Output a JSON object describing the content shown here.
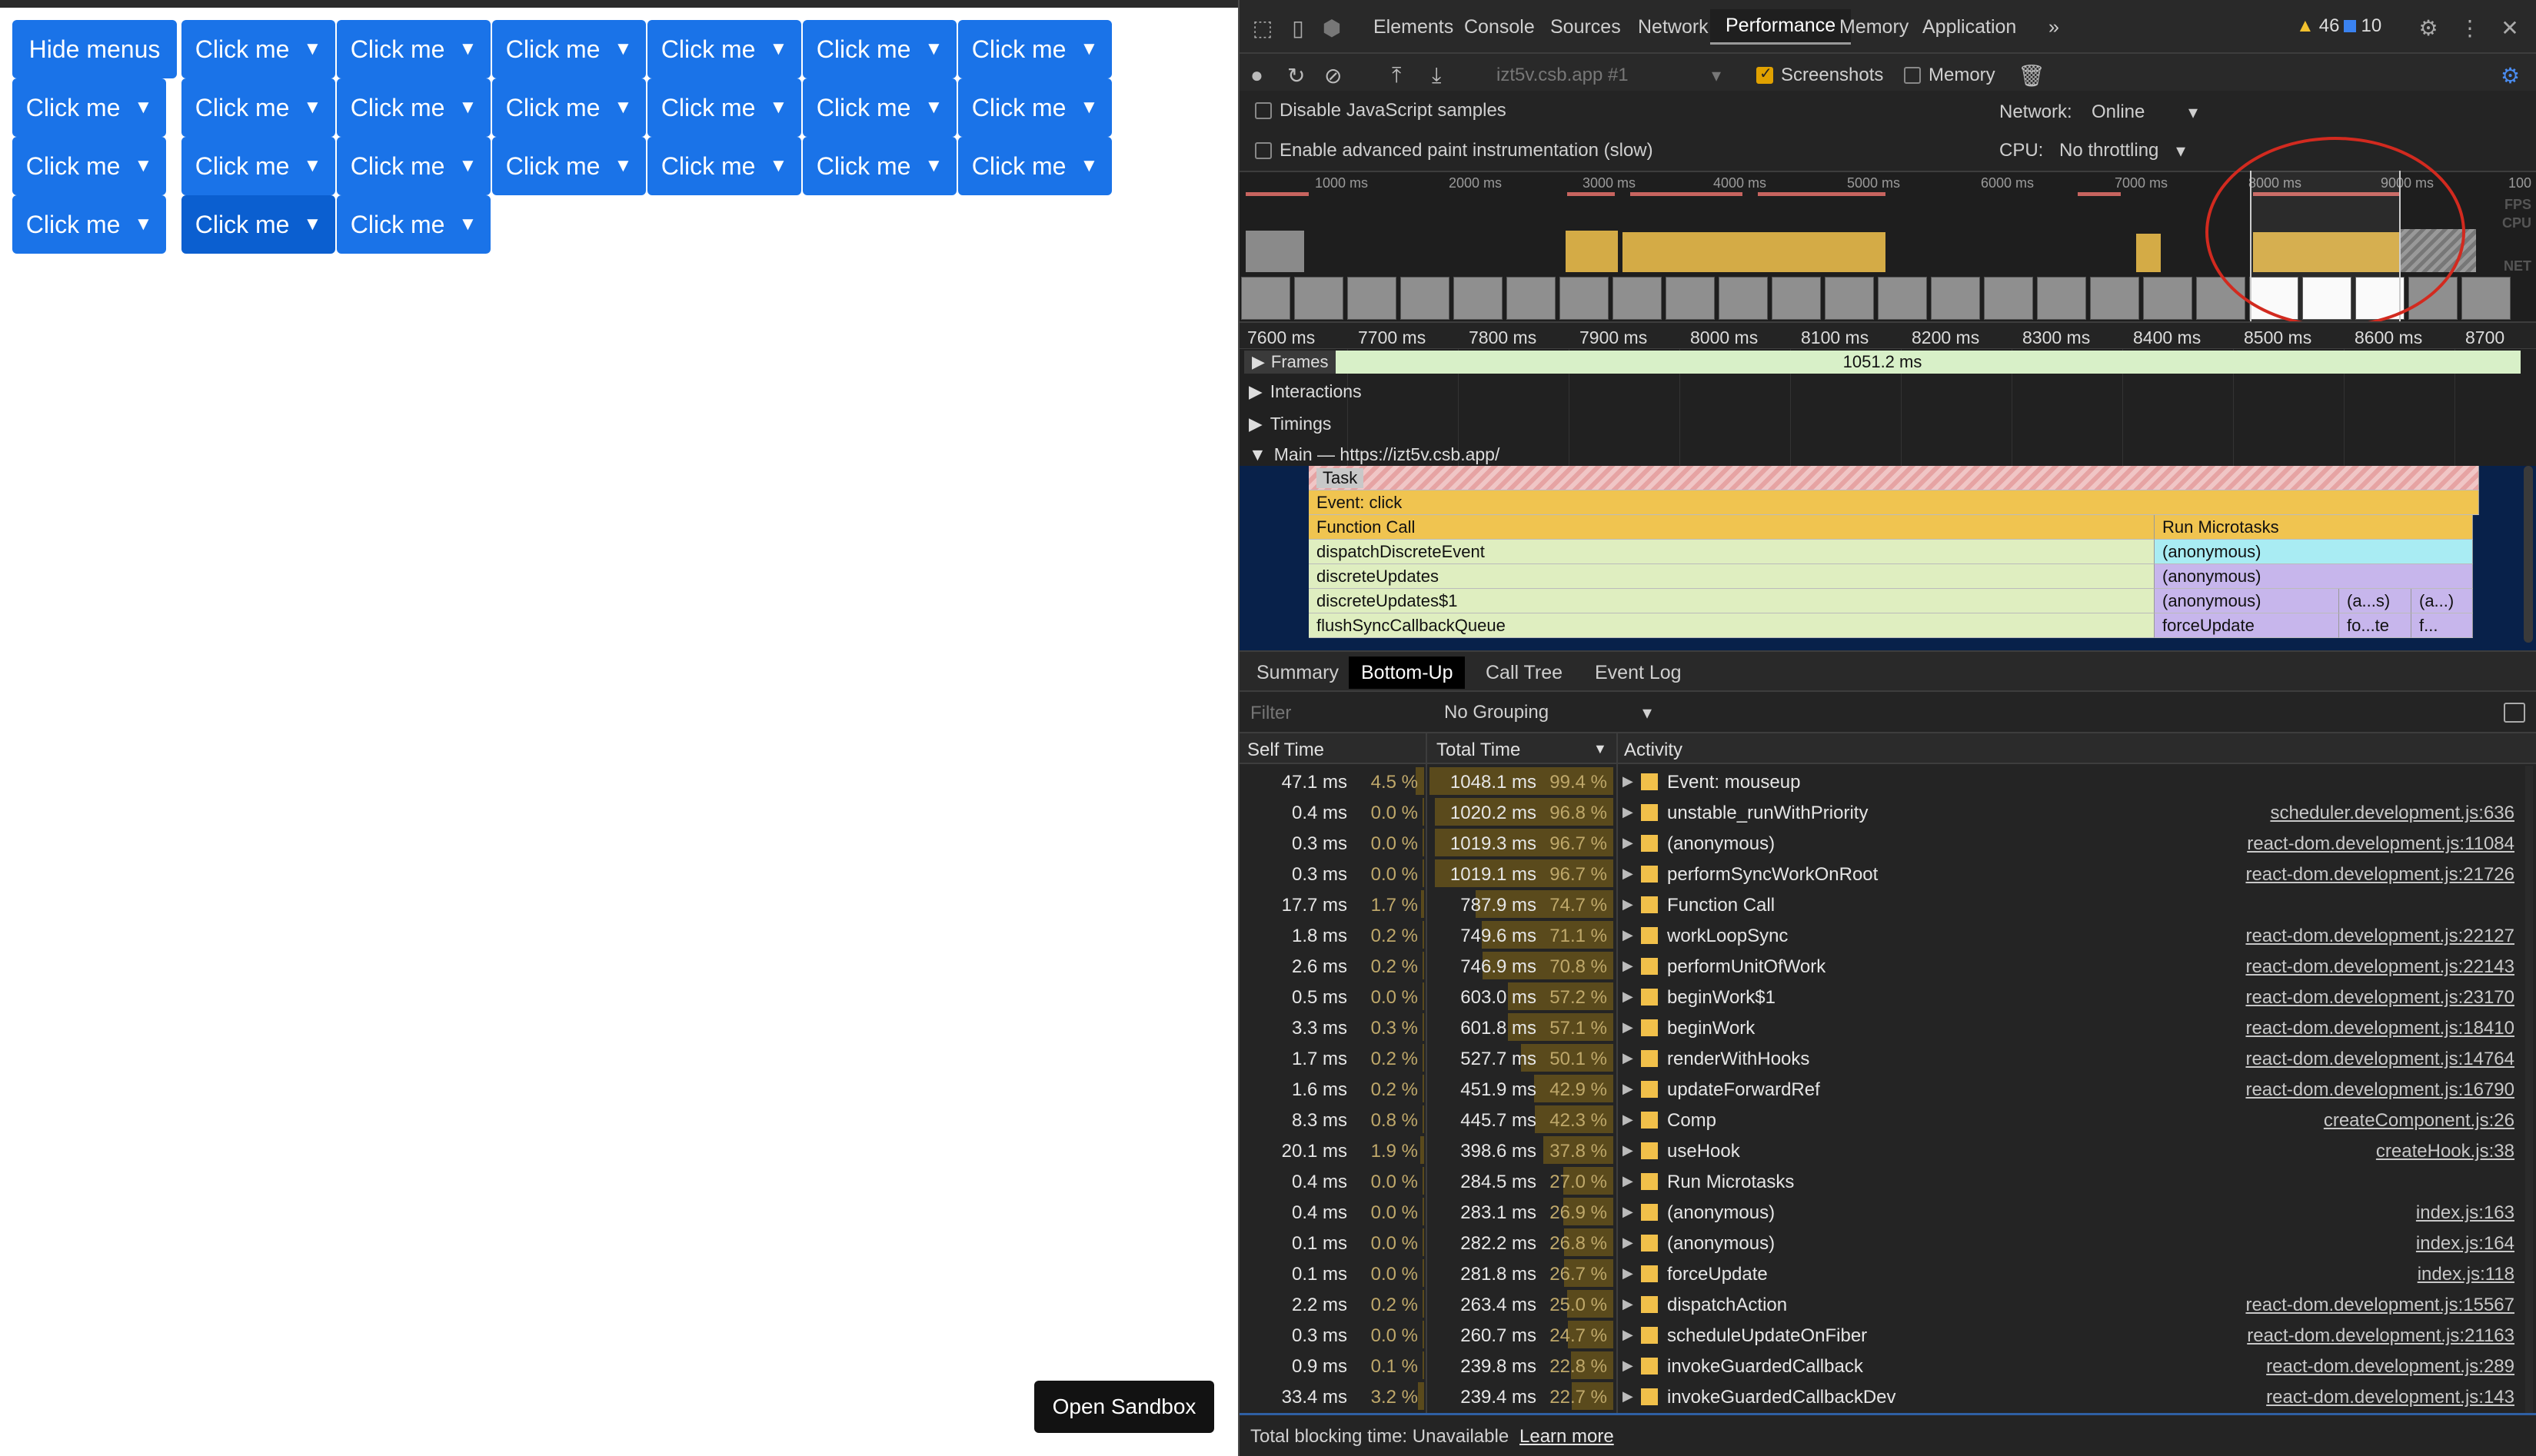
{
  "app": {
    "first_button": "Hide menus",
    "button_label": "Click me",
    "caret": "▼",
    "open_sandbox": "Open Sandbox"
  },
  "devtools": {
    "tabs": [
      "Elements",
      "Console",
      "Sources",
      "Network",
      "Performance",
      "Memory",
      "Application"
    ],
    "active_tab": "Performance",
    "more_tabs": "»",
    "warnings_count": "46",
    "info_count": "10",
    "recording_select": "izt5v.csb.app #1",
    "screenshots_label": "Screenshots",
    "memory_label": "Memory",
    "disable_js_samples": "Disable JavaScript samples",
    "advanced_paint": "Enable advanced paint instrumentation (slow)",
    "network_label": "Network:",
    "network_value": "Online",
    "cpu_label": "CPU:",
    "cpu_value": "No throttling",
    "overview_ticks": [
      "1000 ms",
      "2000 ms",
      "3000 ms",
      "4000 ms",
      "5000 ms",
      "6000 ms",
      "7000 ms",
      "8000 ms",
      "9000 ms",
      "100"
    ],
    "overview_labels": [
      "FPS",
      "CPU",
      "NET"
    ],
    "ruler_ticks": [
      "7600 ms",
      "7700 ms",
      "7800 ms",
      "7900 ms",
      "8000 ms",
      "8100 ms",
      "8200 ms",
      "8300 ms",
      "8400 ms",
      "8500 ms",
      "8600 ms",
      "8700"
    ],
    "frames_label": "Frames",
    "frames_value": "1051.2 ms",
    "interactions_label": "Interactions",
    "timings_label": "Timings",
    "main_label": "Main — https://izt5v.csb.app/",
    "flame": {
      "task": "Task",
      "event_click": "Event: click",
      "function_call": "Function Call",
      "run_microtasks": "Run Microtasks",
      "left": [
        "dispatchDiscreteEvent",
        "discreteUpdates",
        "discreteUpdates$1",
        "flushSyncCallbackQueue"
      ],
      "right": [
        "(anonymous)",
        "(anonymous)",
        "(anonymous)",
        "forceUpdate"
      ],
      "small": [
        "(a...s)",
        "(a...)",
        "fo...te",
        "f..."
      ]
    },
    "bottom_tabs": [
      "Summary",
      "Bottom-Up",
      "Call Tree",
      "Event Log"
    ],
    "active_bottom_tab": "Bottom-Up",
    "filter_placeholder": "Filter",
    "grouping": "No Grouping",
    "columns": [
      "Self Time",
      "Total Time",
      "Activity"
    ],
    "rows": [
      {
        "self": "47.1 ms",
        "self_pct": "4.5 %",
        "total": "1048.1 ms",
        "total_pct": "99.4 %",
        "activity": "Event: mouseup",
        "source": ""
      },
      {
        "self": "0.4 ms",
        "self_pct": "0.0 %",
        "total": "1020.2 ms",
        "total_pct": "96.8 %",
        "activity": "unstable_runWithPriority",
        "source": "scheduler.development.js:636"
      },
      {
        "self": "0.3 ms",
        "self_pct": "0.0 %",
        "total": "1019.3 ms",
        "total_pct": "96.7 %",
        "activity": "(anonymous)",
        "source": "react-dom.development.js:11084"
      },
      {
        "self": "0.3 ms",
        "self_pct": "0.0 %",
        "total": "1019.1 ms",
        "total_pct": "96.7 %",
        "activity": "performSyncWorkOnRoot",
        "source": "react-dom.development.js:21726"
      },
      {
        "self": "17.7 ms",
        "self_pct": "1.7 %",
        "total": "787.9 ms",
        "total_pct": "74.7 %",
        "activity": "Function Call",
        "source": ""
      },
      {
        "self": "1.8 ms",
        "self_pct": "0.2 %",
        "total": "749.6 ms",
        "total_pct": "71.1 %",
        "activity": "workLoopSync",
        "source": "react-dom.development.js:22127"
      },
      {
        "self": "2.6 ms",
        "self_pct": "0.2 %",
        "total": "746.9 ms",
        "total_pct": "70.8 %",
        "activity": "performUnitOfWork",
        "source": "react-dom.development.js:22143"
      },
      {
        "self": "0.5 ms",
        "self_pct": "0.0 %",
        "total": "603.0 ms",
        "total_pct": "57.2 %",
        "activity": "beginWork$1",
        "source": "react-dom.development.js:23170"
      },
      {
        "self": "3.3 ms",
        "self_pct": "0.3 %",
        "total": "601.8 ms",
        "total_pct": "57.1 %",
        "activity": "beginWork",
        "source": "react-dom.development.js:18410"
      },
      {
        "self": "1.7 ms",
        "self_pct": "0.2 %",
        "total": "527.7 ms",
        "total_pct": "50.1 %",
        "activity": "renderWithHooks",
        "source": "react-dom.development.js:14764"
      },
      {
        "self": "1.6 ms",
        "self_pct": "0.2 %",
        "total": "451.9 ms",
        "total_pct": "42.9 %",
        "activity": "updateForwardRef",
        "source": "react-dom.development.js:16790"
      },
      {
        "self": "8.3 ms",
        "self_pct": "0.8 %",
        "total": "445.7 ms",
        "total_pct": "42.3 %",
        "activity": "Comp",
        "source": "createComponent.js:26"
      },
      {
        "self": "20.1 ms",
        "self_pct": "1.9 %",
        "total": "398.6 ms",
        "total_pct": "37.8 %",
        "activity": "useHook",
        "source": "createHook.js:38"
      },
      {
        "self": "0.4 ms",
        "self_pct": "0.0 %",
        "total": "284.5 ms",
        "total_pct": "27.0 %",
        "activity": "Run Microtasks",
        "source": ""
      },
      {
        "self": "0.4 ms",
        "self_pct": "0.0 %",
        "total": "283.1 ms",
        "total_pct": "26.9 %",
        "activity": "(anonymous)",
        "source": "index.js:163"
      },
      {
        "self": "0.1 ms",
        "self_pct": "0.0 %",
        "total": "282.2 ms",
        "total_pct": "26.8 %",
        "activity": "(anonymous)",
        "source": "index.js:164"
      },
      {
        "self": "0.1 ms",
        "self_pct": "0.0 %",
        "total": "281.8 ms",
        "total_pct": "26.7 %",
        "activity": "forceUpdate",
        "source": "index.js:118"
      },
      {
        "self": "2.2 ms",
        "self_pct": "0.2 %",
        "total": "263.4 ms",
        "total_pct": "25.0 %",
        "activity": "dispatchAction",
        "source": "react-dom.development.js:15567"
      },
      {
        "self": "0.3 ms",
        "self_pct": "0.0 %",
        "total": "260.7 ms",
        "total_pct": "24.7 %",
        "activity": "scheduleUpdateOnFiber",
        "source": "react-dom.development.js:21163"
      },
      {
        "self": "0.9 ms",
        "self_pct": "0.1 %",
        "total": "239.8 ms",
        "total_pct": "22.8 %",
        "activity": "invokeGuardedCallback",
        "source": "react-dom.development.js:289"
      },
      {
        "self": "33.4 ms",
        "self_pct": "3.2 %",
        "total": "239.4 ms",
        "total_pct": "22.7 %",
        "activity": "invokeGuardedCallbackDev",
        "source": "react-dom.development.js:143"
      }
    ],
    "total_blocking_label": "Total blocking time: Unavailable",
    "learn_more": "Learn more"
  }
}
